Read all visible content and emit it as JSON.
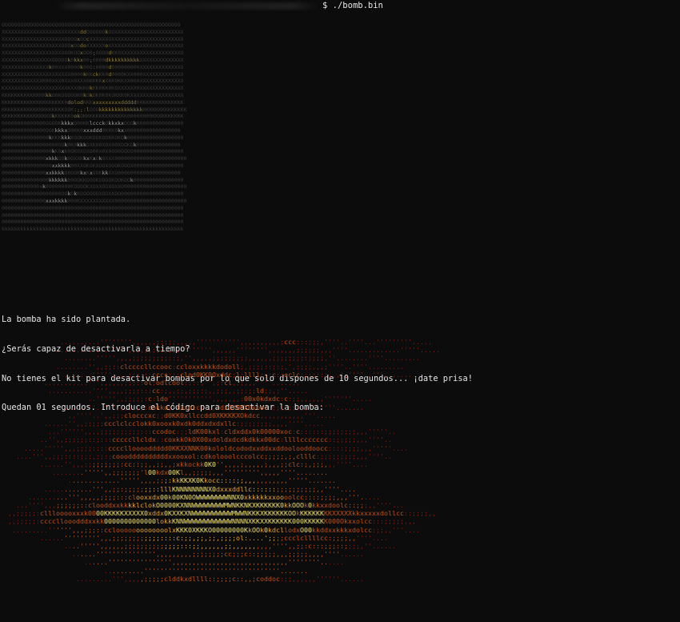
{
  "terminal": {
    "prompt_symbol": "$",
    "command": "./bomb.bin"
  },
  "messages": [
    "La bomba ha sido plantada.",
    "¿Serás capaz de desactivarla a tiempo?",
    "No tienes el kit para desactivar bombas por lo que solo dispones de 10 segundos... ¡date prisa!",
    "Quedan 01 segundos. Introduce el código para desactivar la bomba:"
  ],
  "colors": {
    "background": "#0c0c0c",
    "text": "#e6e6e6",
    "skull_dim": "#3a3a3a",
    "skull_highlight": "#8a7a3a",
    "explosion_outer": "#8b1a0e",
    "explosion_mid": "#c0501a",
    "explosion_inner": "#e8a23a",
    "explosion_core": "#f0e070"
  },
  "skull_art": {
    "rows": [
      "OOOOOOOOOOOOOOOOOOOOOOOOOOOOOOOOOOOOOOOOOOOOOOOOOOOOOOOOO",
      "XXXXXXXXXXXXXXXXXXXXXXXXXddOOOOOOkOOXXXXXXXXXXXXXXXXXXXXXX",
      "XXXXXXXXXXXXXXXXXXXXOOOOxOOcXXXXXXOXXXXXXXXXXXXXXXXXXXXXXX",
      "XXXXXXXXXXXXXXXXXXXOOOxOOdoXXXXXXoXXXXXXXXXXXXXXXXXXXXXXXX",
      "XXXXXXXXXXXXXXXXXXXXOOKOOxOO0;OOOOdKK0XXXXXXXXXXXXXXXXXXXX",
      "XXXXXXXXXXXXXXXXOOOOOk0kkx00;0000dkkkkkkkkkkXXXXXXXXXXXXXX",
      "XXXXXXXXXXXXXXXk00XXX0000k00O:0000d000000000XXXXXXXXXXXXXX",
      "XXXXXXXXXXXXXXXXXXXXXX0000kKKckKK0d0000KXX000XXXXXXXXXXXXX",
      "XXXXXXXXXXXXXK00XXX0XXX0XXX0KKKKxXKK0KKXX000XXXXXXXXXXXXXX",
      "KXXXXXXXXXXXXXXXXXXXXKXX0KK0kKK0KK0K0XXXXXX0XXXXXXXXXXXXXX",
      "KKKKKKKKKKKKKKkkO0KOOOOOK0kOkOK0K0KOKKK0KXXXXXXXXXXXXXXXXX",
      "KKKKKKKKKKKKKKKKKKKK0dolodKKKxxxxxxxxxddddd00KKKKKKKKKKKKK",
      "KKKKKKKKKKKKKKKKKKKKOOK:;;:lOOOkkkkkkkkkkkkkk0KKKKKKKKKKKKK",
      "KKKKKKKKKKKKKKKOkKKKKK0okOKKKKKKKKKKKKKK00000000KKKKKKKKKK",
      "00000000000000OOOOKkkkxO00KKlccckOkkxkxOOOk000000000000000",
      "00000000000000OOKkkkxO0KK0xxxddd0KKK0kxX00000000000000000",
      "000000000000000kKKKkkkKOOKOOKOOKOOKKOKOk000000000000000000",
      "000000000000000000OOk0K0kkkOXKO0X0X00XOOKOk00000000000000",
      "0000000000000000kK0xK0OK0XOXO00X0X0OO0OOOO0000000000000000",
      "00000000000000xkkkOOk0OXXKkxKxOk0XXX00000000000000000000000",
      "0000000000000000xxkkkk00XXOKOKXOOXOOOKOOOX0000000000000000",
      "00000000000000xxkkkkO0OOKkxKxOOKkkXXO00000000000000000000",
      "000000000000000kkkkkk00OOKKOOOKOOOOKOOKOOk0000000000000000",
      "000000000000xk00000000KOOOOKXOXXOOXOXXO00000000000000000000",
      "0000000000000000000OOkOkKOOOOOOXOOXXOO00000000000000000000",
      "00000000000000xxxkkkk000KXXXXXXXXXXX00000000000000000000000",
      "0000000000000000000000000000000000000000000000000000000000",
      "0000000000000000000000000000000000000000000000000000000000",
      "0000000000000000000000000000000000000000000000000000000000",
      "kkkkkkkkkkkkkkkkkkkkkkkkkkkkkkkkkkkkkkkkkkkkkkkkkkkkkkkkkk"
    ]
  },
  "explosion_art": {
    "rows": [
      "               ..........'''''''',,,,,,;;;;;,,,,,''''''''''',,,,,,,,,,;ccc:::;;;,''''..''''...'''''''''.....",
      "              .............''''',,,,;;;;:;,,,'''''''',,,,,,'''''''',,,,,,,;;;;;;,,,''''.............'''''.....",
      "                ........''''',,,,;;;;;;;;;::;,'',,,,,;;;;;;;;;,,,,,,;;;;;;;;:;;;;,''........''''.........",
      "              ........'',,;;::clccccllccooc:ccloxxkkkkdodoll;,;;;;::;:;,',;;;;,,,;''''..''''.........",
      "                .......''''',,,,;;;;::cccc:;;clod0KK0Oxddc;l;llll;;:c::cclc:;;:::;,,,',''''..'''.......",
      "           ...........''',,,,,,;;;::ol;odlcool:;::,'',;:cl,;;,,,''''.......",
      "            ...........'''',,,,;;;;:::cc:;,,;;,;;;:;,,;;;,,;;:;;ld;;,;''.....",
      "                      ..''''',,;;;;;:c:ldo''''''''''',,,,,,,:00x0kdxdc:c:;;,,,,,,'''''''.....",
      "               ......'''..''',,,;,,;:cokko;:lxxolc:;,,cdxOXNKX0xooc:;;;;;;;;,,''''''.......",
      "                 ..''''..',,;;;clocccxc;;d0KK0xllccdd0XKKKKXOkdcc,,,,,,,,,,,'''.....",
      "           ......'',,;;;;;ccclclcclokk0xooxk0xdk0ddxdxdxllc:;;;;;;;;,,,,''''.....",
      "            ...'''''',,,,;;;;;;;;;;:::ccodoc:;;ldK00kxl:cldxddx0k00000xoc:c::::::;;;;;;;;,,,'''''..",
      "          ..'',,;;;;;;::;:::cccccllcldx::coxkkOk0X00xdoldxdcdkdkkx00dc:llllccccccc::;;;;;,,,''''..",
      "      .....''''',,,;;;;::::ccccllooooddddd0KKXXNNK00kololdcododxxddxxddoolooddoocc::::;;;;,,,'''''....",
      "    ....''',,;;;::::;;;,;;::coooddddddddddxxooxol:cdkolooolcccolcc;;;;;,;,clllc:;;;;;;;;;,,,''''..",
      "          ......'',,,;;;;;;;;;:cc::;;,,;;,,;xkkockk0K0'',,,,;,,,,,;,,,;;clc:;,;;;,,,''''....",
      "             ........''''',,;;;;;;;'l00kdx00Kl,,;;;;;,,,''''''''',,,,,''''........",
      "                 .............''''',,,,;;;:kkKKXK0Kkocc::::;;,,,,,,,,,,,'''''.......",
      "           ............''',,;;:;;;;;;;::lllKNNNNNNNNX0dxxxddllc::::::;;;;;;;;;;,,''''....",
      "       ..........''',,,,,;;;;:::clooxxdx00k00KN0OWWWWWWWWNNX0xkkkkkxxoooolcc::::;;;;,,,'''.....",
      "    ...'''',,,;;;;;;::clooddxxkkkklclokO0000KXNNWWWWWWWWMWNKKNKXKKKKKK0kkOOOk0kkxxdoolc::;;;,,''''...",
      "  ,,;;;;;:clllooooxxxk0000KKKKKXXXXX0xddx0KXXKXNWWWWWWWWWWMWWNKKKXKKKKKKOOkKKKKKKKKXXXXXkkxxxxxdollcc::;;;;,,",
      "  ,,;;;;;:ccccllooodddxxkk0000000000000lokkKNNWWWWWWWWWWWWNNNNXKKXXKKKKKK000KKKKKK000Okxxolcc:::;;;;;,,,",
      "   .........'''''',,,;;;::cclooooooooooooolxKKK0XKKKO00000000KkOOk0kdcllodxO00kkddxxkkkxdolcc:;;,,'''....",
      "          ......''''''''',,,;;;;;;;;;;;;::::c:;;,;;,;;,;;;;ol:....';;;;ccclcllllcc:;;;;,,''''....",
      "                ....''''',,,,,,;;;;;;;;;;;;;;:::;;,,,,,,;;,,,,,,,,,,'''',,;;:c:::;;;::;;;;,''......",
      "                  ......''''''''''''''',,,,,,,,,;;;;;;;;cc;;;c::;;;;;,,,;;;;;,,,,''''......",
      "                     ......'''''''''''''''',,,,,,,,,,,,,,,,,,,,,,,,,,,,,''''''''......",
      "                          ..........''''''''''''''''''''''''''''''''''.......",
      "                   .........''',,,,,;;;;;clddkxdllll::;;;;c::,,;coddoc:;;,,,,,,''''''......"
    ]
  }
}
